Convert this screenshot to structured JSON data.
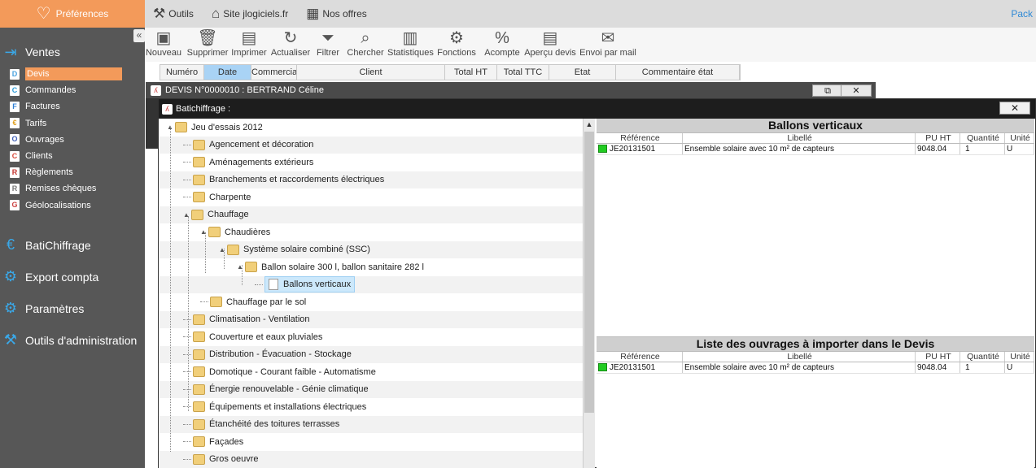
{
  "sidebar": {
    "preferences": "Préférences",
    "section_ventes": "Ventes",
    "items": [
      {
        "label": "Devis",
        "icon_letter": "D",
        "active": true
      },
      {
        "label": "Commandes",
        "icon_letter": "C"
      },
      {
        "label": "Factures",
        "icon_letter": "F"
      },
      {
        "label": "Tarifs",
        "icon_letter": "€"
      },
      {
        "label": "Ouvrages",
        "icon_letter": "O"
      },
      {
        "label": "Clients",
        "icon_letter": "C"
      },
      {
        "label": "Règlements",
        "icon_letter": "R"
      },
      {
        "label": "Remises chèques",
        "icon_letter": "R"
      },
      {
        "label": "Géolocalisations",
        "icon_letter": "G"
      }
    ],
    "sections": [
      {
        "label": "BatiChiffrage",
        "icon": "euro-icon"
      },
      {
        "label": "Export compta",
        "icon": "gears-icon"
      },
      {
        "label": "Paramètres",
        "icon": "gear-icon"
      },
      {
        "label": "Outils d'administration",
        "icon": "tools-icon"
      }
    ]
  },
  "topbar": {
    "outils": "Outils",
    "site": "Site jlogiciels.fr",
    "offres": "Nos offres",
    "pack": "Pack"
  },
  "toolbar": [
    {
      "label": "Nouveau",
      "icon": "new-icon"
    },
    {
      "label": "Supprimer",
      "icon": "trash-icon"
    },
    {
      "label": "Imprimer",
      "icon": "print-icon"
    },
    {
      "label": "Actualiser",
      "icon": "refresh-icon"
    },
    {
      "label": "Filtrer",
      "icon": "filter-icon"
    },
    {
      "label": "Chercher",
      "icon": "search-icon"
    },
    {
      "label": "Statistiques",
      "icon": "stats-icon"
    },
    {
      "label": "Fonctions",
      "icon": "functions-icon"
    },
    {
      "label": "Acompte",
      "icon": "percent-icon"
    },
    {
      "label": "Aperçu devis",
      "icon": "preview-icon"
    },
    {
      "label": "Envoi par mail",
      "icon": "mail-icon"
    }
  ],
  "list_columns": [
    "Numéro",
    "Date",
    "Commercia",
    "Client",
    "Total HT",
    "Total TTC",
    "Etat",
    "Commentaire état"
  ],
  "devis_window": {
    "title": "DEVIS N°0000010 : BERTRAND Céline"
  },
  "bati_window": {
    "title": "Batichiffrage :"
  },
  "tree": [
    {
      "label": "Jeu d'essais 2012",
      "level": 0,
      "type": "folder",
      "expanded": true
    },
    {
      "label": "Agencement et décoration",
      "level": 1,
      "type": "folder"
    },
    {
      "label": "Aménagements extérieurs",
      "level": 1,
      "type": "folder"
    },
    {
      "label": "Branchements et raccordements électriques",
      "level": 1,
      "type": "folder"
    },
    {
      "label": "Charpente",
      "level": 1,
      "type": "folder"
    },
    {
      "label": "Chauffage",
      "level": 1,
      "type": "folder",
      "expanded": true
    },
    {
      "label": "Chaudières",
      "level": 2,
      "type": "folder",
      "expanded": true
    },
    {
      "label": "Système solaire combiné (SSC)",
      "level": 3,
      "type": "folder",
      "expanded": true
    },
    {
      "label": "Ballon solaire 300 l, ballon sanitaire 282 l",
      "level": 4,
      "type": "folder",
      "expanded": true
    },
    {
      "label": "Ballons verticaux",
      "level": 5,
      "type": "doc",
      "selected": true
    },
    {
      "label": "Chauffage par le sol",
      "level": 2,
      "type": "folder"
    },
    {
      "label": "Climatisation - Ventilation",
      "level": 1,
      "type": "folder"
    },
    {
      "label": "Couverture et eaux pluviales",
      "level": 1,
      "type": "folder"
    },
    {
      "label": "Distribution - Évacuation - Stockage",
      "level": 1,
      "type": "folder"
    },
    {
      "label": "Domotique - Courant faible - Automatisme",
      "level": 1,
      "type": "folder"
    },
    {
      "label": "Énergie renouvelable - Génie climatique",
      "level": 1,
      "type": "folder"
    },
    {
      "label": "Équipements et installations électriques",
      "level": 1,
      "type": "folder"
    },
    {
      "label": "Étanchéité des toitures terrasses",
      "level": 1,
      "type": "folder"
    },
    {
      "label": "Façades",
      "level": 1,
      "type": "folder"
    },
    {
      "label": "Gros oeuvre",
      "level": 1,
      "type": "folder"
    }
  ],
  "panel_top": {
    "title": "Ballons verticaux",
    "columns": [
      "Référence",
      "Libellé",
      "PU HT",
      "Quantité",
      "Unité"
    ],
    "rows": [
      {
        "ref": "JE20131501",
        "libelle": "Ensemble solaire avec 10 m² de capteurs",
        "pu": "9048.04",
        "qte": "1",
        "unite": "U"
      }
    ]
  },
  "panel_bottom": {
    "title": "Liste des ouvrages à importer dans le Devis",
    "columns": [
      "Référence",
      "Libellé",
      "PU HT",
      "Quantité",
      "Unité"
    ],
    "rows": [
      {
        "ref": "JE20131501",
        "libelle": "Ensemble solaire avec 10 m² de capteurs",
        "pu": "9048.04",
        "qte": "1",
        "unite": "U"
      }
    ]
  },
  "colors": {
    "accent_orange": "#f39a5a",
    "sidebar_bg": "#575757",
    "selection_blue": "#a9d3f5",
    "status_green": "#22cc22"
  }
}
